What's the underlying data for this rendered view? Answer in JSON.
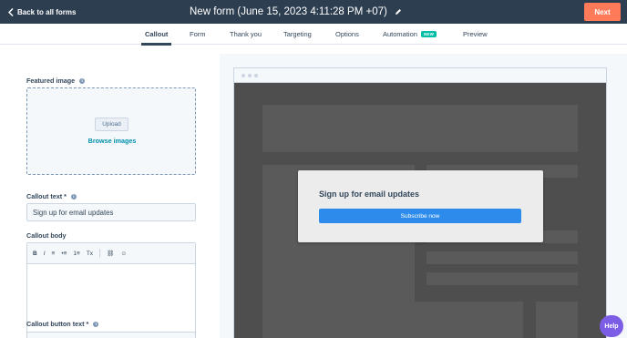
{
  "header": {
    "back_label": "Back to all forms",
    "title": "New form (June 15, 2023 4:11:28 PM +07)",
    "next_label": "Next"
  },
  "tabs": [
    {
      "label": "Callout",
      "active": true
    },
    {
      "label": "Form"
    },
    {
      "label": "Thank you"
    },
    {
      "label": "Targeting"
    },
    {
      "label": "Options"
    },
    {
      "label": "Automation",
      "badge": "NEW"
    },
    {
      "label": "Preview"
    }
  ],
  "editor": {
    "featured_image_label": "Featured image",
    "upload_label": "Upload",
    "browse_label": "Browse images",
    "callout_text_label": "Callout text *",
    "callout_text_value": "Sign up for email updates",
    "callout_body_label": "Callout body",
    "toolbar": {
      "bold": "B",
      "italic": "I",
      "align": "≡",
      "bullets": "•≡",
      "numbers": "1≡",
      "clear": "Tx",
      "link": "⛓",
      "emoji": "☺"
    },
    "callout_button_label": "Callout button text *"
  },
  "preview": {
    "popup_title": "Sign up for email updates",
    "popup_button": "Subscribe now"
  },
  "help_label": "Help",
  "colors": {
    "topbar": "#2d3e50",
    "next": "#ff7a59",
    "accent_link": "#0091ae",
    "badge": "#00bda5",
    "popup_button": "#2d8ceb",
    "help": "#7c5ee6"
  }
}
